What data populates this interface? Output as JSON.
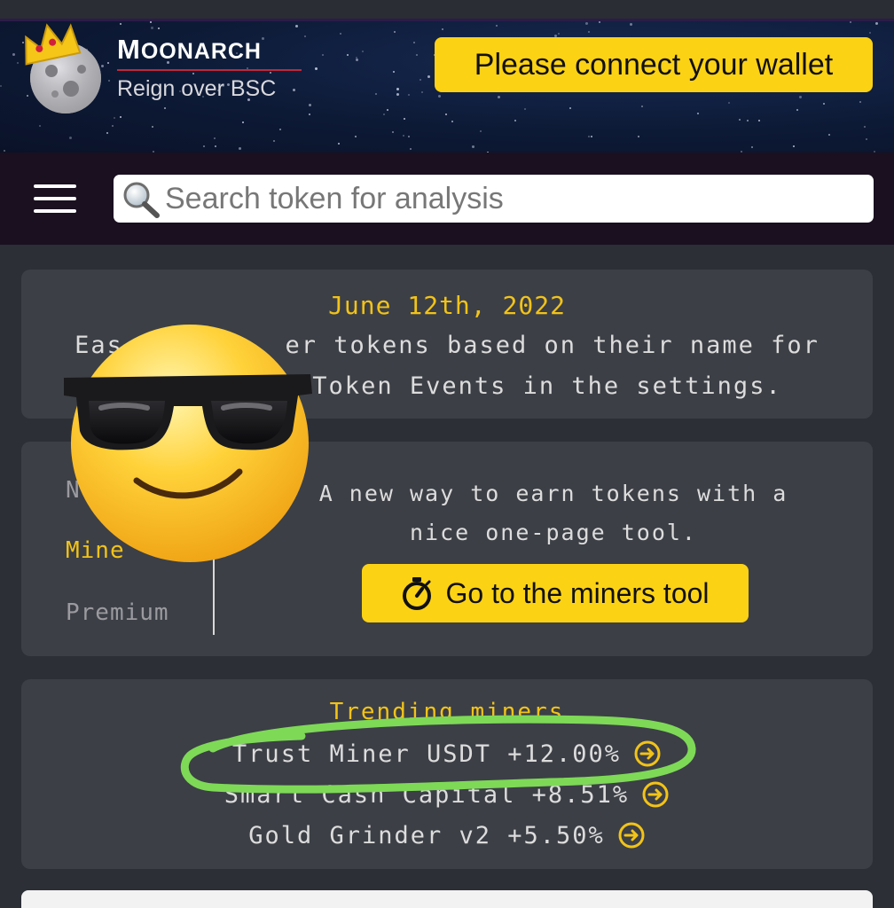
{
  "header": {
    "brand_name_initial": "M",
    "brand_name_rest": "OONARCH",
    "tagline": "Reign over BSC",
    "connect_button": "Please connect your wallet"
  },
  "navbar": {
    "search_placeholder": "Search token for analysis"
  },
  "news": {
    "date": "June 12th, 2022",
    "line1": "Eas          er tokens based on their name for",
    "line2": "Token Events in the settings."
  },
  "tools": {
    "tabs": [
      "N",
      "Mine",
      "Premium"
    ],
    "active_tab_index": 1,
    "description_line1": "A new way to earn tokens with a",
    "description_line2": "nice one-page tool.",
    "button_label": "Go to the miners tool"
  },
  "trending": {
    "title": "Trending miners",
    "items": [
      {
        "label": "Trust Miner USDT +12.00%"
      },
      {
        "label": "Smart Cash Capital +8.51%"
      },
      {
        "label": "Gold Grinder v2 +5.50%"
      }
    ]
  },
  "colors": {
    "accent_yellow": "#fcd215",
    "card_bg": "#3c3f46",
    "page_bg": "#2c2f36",
    "highlight_green": "#7ed957"
  },
  "overlays": {
    "emoji": "smiling-face-with-sunglasses",
    "annotation": "green-hand-drawn-circle"
  }
}
